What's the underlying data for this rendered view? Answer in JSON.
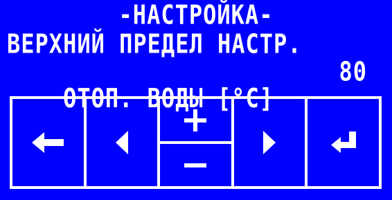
{
  "screen": {
    "title": "-НАСТРОЙКА-",
    "line2": "ВЕРХНИЙ ПРЕДЕЛ НАСТР.",
    "line3_label": "ОТОП. ВОДЫ [°C]",
    "line3_value": "80"
  },
  "keypad": {
    "keys": [
      {
        "icon": "arrow-left-icon"
      },
      {
        "icon": "triangle-left-icon"
      },
      {
        "icon_top": "plus-icon",
        "icon_bottom": "minus-icon"
      },
      {
        "icon": "triangle-right-icon"
      },
      {
        "icon": "enter-icon"
      }
    ]
  },
  "colors": {
    "background": "#0000ff",
    "foreground": "#ffffff"
  }
}
